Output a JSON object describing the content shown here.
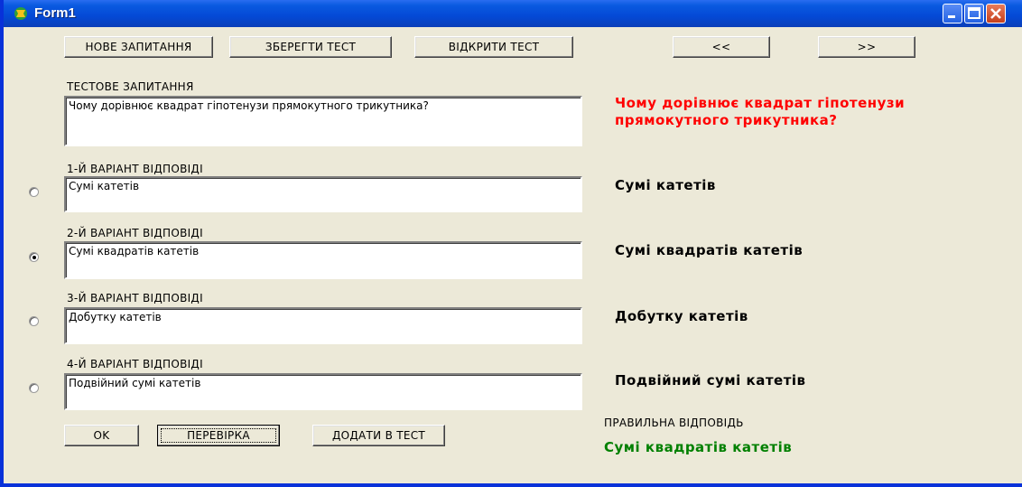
{
  "window": {
    "title": "Form1"
  },
  "toolbar": {
    "new_question": "НОВЕ ЗАПИТАННЯ",
    "save_test": "ЗБЕРЕГТИ ТЕСТ",
    "open_test": "ВІДКРИТИ ТЕСТ",
    "prev": "<<",
    "next": ">>"
  },
  "question": {
    "label": "ТЕСТОВЕ ЗАПИТАННЯ",
    "text": "Чому дорівнює квадрат гіпотенузи прямокутного трикутника?",
    "display": "Чому дорівнює квадрат гіпотенузи прямокутного трикутника?"
  },
  "answers": [
    {
      "label": "1-Й ВАРІАНТ ВІДПОВІДІ",
      "text": "Сумі катетів",
      "display": "Сумі катетів",
      "selected": false
    },
    {
      "label": "2-Й ВАРІАНТ ВІДПОВІДІ",
      "text": "Сумі квадратів катетів",
      "display": "Сумі квадратів катетів",
      "selected": true
    },
    {
      "label": "3-Й ВАРІАНТ ВІДПОВІДІ",
      "text": "Добутку катетів",
      "display": "Добутку катетів",
      "selected": false
    },
    {
      "label": "4-Й ВАРІАНТ ВІДПОВІДІ",
      "text": "Подвійний сумі катетів",
      "display": "Подвійний сумі катетів",
      "selected": false
    }
  ],
  "bottom": {
    "ok": "OK",
    "check": "ПЕРЕВІРКА",
    "add_to_test": "ДОДАТИ В ТЕСТ"
  },
  "result": {
    "label": "ПРАВИЛЬНА ВІДПОВІДЬ",
    "answer": "Сумі квадратів катетів"
  },
  "colors": {
    "question_display": "#ff0000",
    "correct_answer": "#008000",
    "titlebar": "#0a5ae0"
  }
}
